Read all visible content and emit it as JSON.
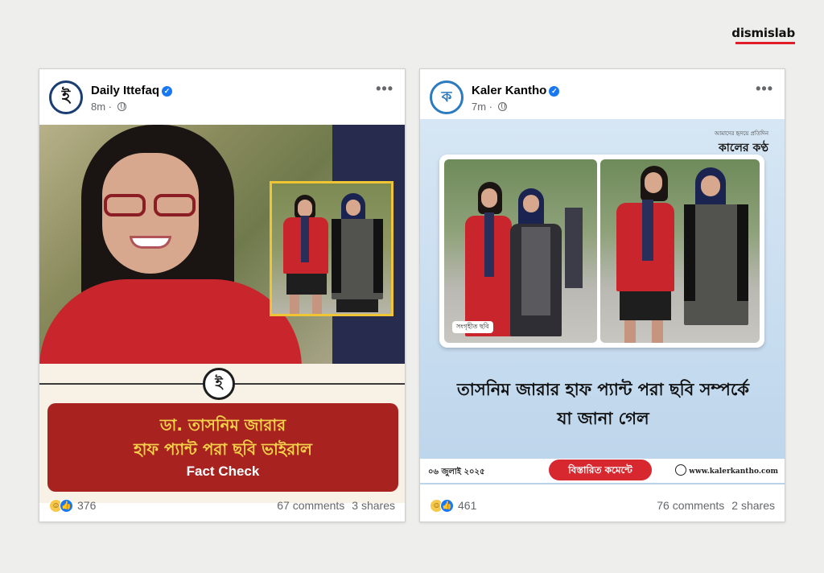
{
  "brand": {
    "name": "dismislab",
    "accent": "#e11d2a"
  },
  "posts": [
    {
      "page_name": "Daily Ittefaq",
      "avatar_text": "ই",
      "time": "8m",
      "privacy_icon": "globe-icon",
      "menu_glyph": "•••",
      "image": {
        "headline_line1": "ডা. তাসনিম জারার",
        "headline_line2": "হাফ প্যান্ট পরা ছবি ভাইরাল",
        "tag": "Fact Check",
        "emblem": "ই",
        "banner_color": "#a8231f"
      },
      "reactions": "376",
      "comments": "67 comments",
      "shares": "3 shares"
    },
    {
      "page_name": "Kaler Kantho",
      "avatar_text": "ক",
      "time": "7m",
      "privacy_icon": "globe-icon",
      "menu_glyph": "•••",
      "image": {
        "logo_small": "আমাদের হৃদয়ে প্রতিদিন",
        "logo": "কালের কণ্ঠ",
        "photo_tag": "সংগৃহীত ছবি",
        "headline_line1": "তাসনিম জারার হাফ প্যান্ট পরা ছবি সম্পর্কে",
        "headline_line2": "যা জানা গেল",
        "date": "০৬ জুলাই ২০২৫",
        "pill": "বিস্তারিত কমেন্টে",
        "site": "www.kalerkantho.com"
      },
      "reactions": "461",
      "comments": "76 comments",
      "shares": "2 shares"
    }
  ]
}
